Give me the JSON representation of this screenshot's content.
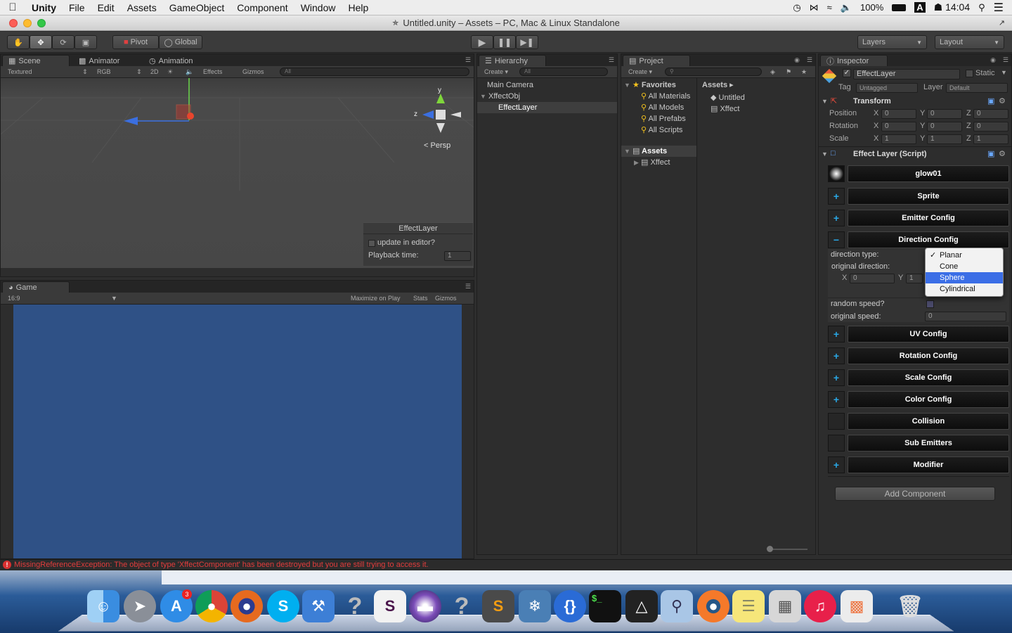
{
  "menubar": {
    "app_name": "Unity",
    "items": [
      "File",
      "Edit",
      "Assets",
      "GameObject",
      "Component",
      "Window",
      "Help"
    ],
    "battery": "100%",
    "clock": "☗ 14:04",
    "input_indicator": "A"
  },
  "window": {
    "title": "Untitled.unity – Assets – PC, Mac & Linux Standalone"
  },
  "toolbar": {
    "pivot_label": "Pivot",
    "global_label": "Global",
    "layers_label": "Layers",
    "layout_label": "Layout"
  },
  "scene": {
    "tabs": [
      "Scene",
      "Animator",
      "Animation"
    ],
    "shading": "Textured",
    "render_mode": "RGB",
    "mode_2d": "2D",
    "effects_label": "Effects",
    "gizmos_label": "Gizmos",
    "search_placeholder": "All",
    "persp_label": "Persp",
    "axis_y": "y",
    "axis_z": "z",
    "overlay": {
      "title": "EffectLayer",
      "update_label": "update in editor?",
      "playback_label": "Playback time:",
      "playback_value": "1"
    }
  },
  "game": {
    "tab": "Game",
    "aspect": "16:9",
    "maximize_label": "Maximize on Play",
    "stats_label": "Stats",
    "gizmos_label": "Gizmos"
  },
  "hierarchy": {
    "tab": "Hierarchy",
    "create_label": "Create",
    "search_placeholder": "All",
    "items": [
      "Main Camera",
      "XffectObj",
      "EffectLayer"
    ]
  },
  "project": {
    "tab": "Project",
    "create_label": "Create",
    "favorites_label": "Favorites",
    "favorites": [
      "All Materials",
      "All Models",
      "All Prefabs",
      "All Scripts"
    ],
    "assets_label": "Assets",
    "folders": [
      "Xffect"
    ],
    "breadcrumb": "Assets",
    "files": [
      "Untitled",
      "Xffect"
    ]
  },
  "inspector": {
    "tab": "Inspector",
    "object_name": "EffectLayer",
    "static_label": "Static",
    "tag_label": "Tag",
    "tag_value": "Untagged",
    "layer_label": "Layer",
    "layer_value": "Default",
    "transform": {
      "title": "Transform",
      "rows": [
        {
          "label": "Position",
          "x": "0",
          "y": "0",
          "z": "0"
        },
        {
          "label": "Rotation",
          "x": "0",
          "y": "0",
          "z": "0"
        },
        {
          "label": "Scale",
          "x": "1",
          "y": "1",
          "z": "1"
        }
      ]
    },
    "script_title": "Effect Layer (Script)",
    "texture_label": "glow01",
    "sections": [
      {
        "label": "Sprite",
        "toggle": "+"
      },
      {
        "label": "Emitter Config",
        "toggle": "+"
      },
      {
        "label": "Direction Config",
        "toggle": "−"
      },
      {
        "label": "UV Config",
        "toggle": "+"
      },
      {
        "label": "Rotation Config",
        "toggle": "+"
      },
      {
        "label": "Scale Config",
        "toggle": "+"
      },
      {
        "label": "Color Config",
        "toggle": "+"
      },
      {
        "label": "Collision",
        "toggle": ""
      },
      {
        "label": "Sub Emitters",
        "toggle": ""
      },
      {
        "label": "Modifier",
        "toggle": "+"
      }
    ],
    "direction": {
      "type_label": "direction type:",
      "original_direction_label": "original direction:",
      "x": "0",
      "y": "1",
      "random_speed_label": "random speed?",
      "original_speed_label": "original speed:",
      "original_speed_value": "0",
      "dropdown_options": [
        "Planar",
        "Cone",
        "Sphere",
        "Cylindrical"
      ],
      "checked_option": "Planar",
      "highlighted_option": "Sphere"
    },
    "add_component_label": "Add Component"
  },
  "status": {
    "error_message": "MissingReferenceException: The object of type 'XffectComponent' has been destroyed but you are still trying to access it."
  },
  "colors": {
    "game_view_bg": "#2f5186",
    "error_text": "#e23c3c",
    "highlight": "#3b6ee6",
    "plus_toggle": "#29a8e6"
  }
}
